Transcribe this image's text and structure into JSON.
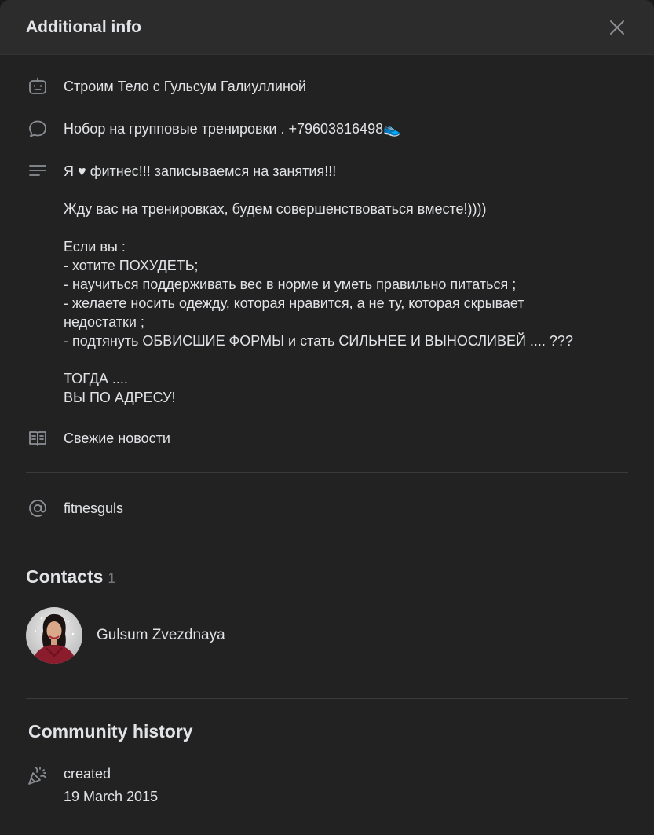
{
  "header": {
    "title": "Additional info"
  },
  "info": {
    "name": "Строим Тело с Гульсум Галиуллиной",
    "status": "Нобор на групповые тренировки . +79603816498👟",
    "description": [
      "Я ♥ фитнес!!! записываемся на занятия!!!",
      "",
      "Жду вас на тренировках, будем совершенствоваться вместе!))))",
      "",
      "Если вы :",
      "- хотите ПОХУДЕТЬ;",
      "- научиться поддерживать вес в норме и уметь правильно питаться ;",
      "- желаете носить одежду, которая нравится, а не ту, которая скрывает",
      "недостатки ;",
      "- подтянуть ОБВИСШИЕ ФОРМЫ и стать СИЛЬНЕЕ И ВЫНОСЛИВЕЙ .... ???",
      "",
      "ТОГДА ....",
      "ВЫ ПО АДРЕСУ!"
    ],
    "news_link": "Свежие новости",
    "short_address": "fitnesguls"
  },
  "contacts": {
    "title": "Contacts",
    "count": "1",
    "items": [
      {
        "name": "Gulsum Zvezdnaya"
      }
    ]
  },
  "history": {
    "title": "Community history",
    "event": "created",
    "date": "19 March 2015"
  },
  "icons": {
    "close": "close-icon",
    "name": "bot-icon",
    "status": "message-icon",
    "description": "text-lines-icon",
    "news": "book-icon",
    "address": "at-icon",
    "history": "party-icon"
  },
  "colors": {
    "background": "#222222",
    "header": "#2c2c2c",
    "link": "#71aaeb",
    "text": "#e1e3e6",
    "muted": "#8c8f94"
  }
}
